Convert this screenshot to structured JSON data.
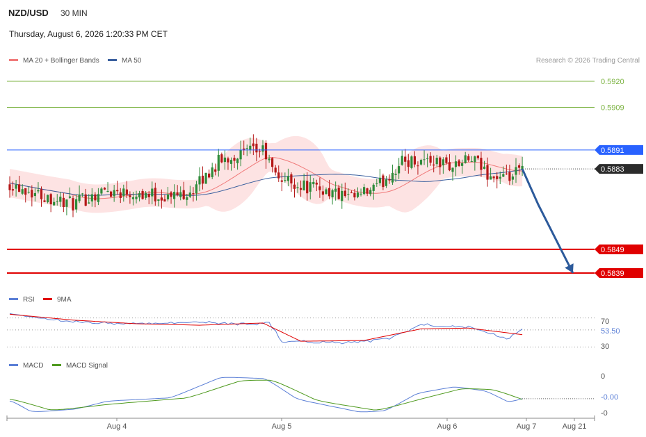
{
  "header": {
    "symbol": "NZD/USD",
    "interval": "30 MIN",
    "datetime": "Thursday, August 6, 2026 1:20:33 PM CET",
    "credit": "Research © 2026 Trading Central"
  },
  "colors": {
    "bollinger_fill": "#fde3e3",
    "ma20": "#f07a7a",
    "ma50": "#3a5f9e",
    "candle_up": "#2e8b3a",
    "candle_down": "#b51818",
    "target_line": "#7cb342",
    "resistance_line": "#2962ff",
    "support_line": "#e00000",
    "arrow": "#2c5a9b",
    "rsi": "#5b7fd6",
    "rsi_ma": "#e00000",
    "macd": "#5b7fd6",
    "macd_signal": "#4f9a1f"
  },
  "chart_data": [
    {
      "type": "candlestick",
      "legend": [
        {
          "name": "MA 20 + Bollinger Bands",
          "color": "#f07a7a"
        },
        {
          "name": "MA 50",
          "color": "#3a5f9e"
        }
      ],
      "y_range": [
        0.5834,
        0.5925
      ],
      "x_labels": [
        "Aug 4",
        "Aug 5",
        "Aug 6",
        "Aug 7",
        "Aug 21"
      ],
      "price_levels": [
        {
          "value": "0.5920",
          "kind": "target"
        },
        {
          "value": "0.5909",
          "kind": "target"
        },
        {
          "value": "0.5891",
          "kind": "resistance"
        },
        {
          "value": "0.5883",
          "kind": "current"
        },
        {
          "value": "0.5849",
          "kind": "support"
        },
        {
          "value": "0.5839",
          "kind": "support"
        }
      ],
      "close_path": [
        {
          "bar": 0,
          "close": 0.5877
        },
        {
          "bar": 10,
          "close": 0.5872
        },
        {
          "bar": 20,
          "close": 0.5868
        },
        {
          "bar": 30,
          "close": 0.5874
        },
        {
          "bar": 40,
          "close": 0.5873
        },
        {
          "bar": 50,
          "close": 0.5871
        },
        {
          "bar": 58,
          "close": 0.5874
        },
        {
          "bar": 66,
          "close": 0.5886
        },
        {
          "bar": 72,
          "close": 0.5889
        },
        {
          "bar": 80,
          "close": 0.5891
        },
        {
          "bar": 84,
          "close": 0.588
        },
        {
          "bar": 92,
          "close": 0.5876
        },
        {
          "bar": 100,
          "close": 0.5874
        },
        {
          "bar": 108,
          "close": 0.587
        },
        {
          "bar": 116,
          "close": 0.5875
        },
        {
          "bar": 124,
          "close": 0.5886
        },
        {
          "bar": 132,
          "close": 0.5887
        },
        {
          "bar": 140,
          "close": 0.5884
        },
        {
          "bar": 146,
          "close": 0.5887
        },
        {
          "bar": 152,
          "close": 0.588
        },
        {
          "bar": 157,
          "close": 0.5878
        },
        {
          "bar": 162,
          "close": 0.5883
        }
      ],
      "forecast": [
        {
          "bar": 162,
          "value": 0.5883
        },
        {
          "bar": 167,
          "value": 0.5868
        },
        {
          "bar": 178,
          "value": 0.5839
        }
      ]
    },
    {
      "type": "line",
      "legend": [
        {
          "name": "RSI",
          "color": "#5b7fd6"
        },
        {
          "name": "9MA",
          "color": "#e00000"
        }
      ],
      "y_range": [
        20,
        82
      ],
      "levels": [
        "70",
        "30"
      ],
      "current_label": "53.50",
      "rsi_path": [
        {
          "bar": 0,
          "value": 75
        },
        {
          "bar": 20,
          "value": 64
        },
        {
          "bar": 40,
          "value": 62
        },
        {
          "bar": 60,
          "value": 64
        },
        {
          "bar": 75,
          "value": 62
        },
        {
          "bar": 82,
          "value": 63
        },
        {
          "bar": 86,
          "value": 38
        },
        {
          "bar": 100,
          "value": 36
        },
        {
          "bar": 110,
          "value": 37
        },
        {
          "bar": 120,
          "value": 42
        },
        {
          "bar": 130,
          "value": 60
        },
        {
          "bar": 145,
          "value": 58
        },
        {
          "bar": 157,
          "value": 40
        },
        {
          "bar": 162,
          "value": 53.5
        }
      ],
      "rsi_ma_path": [
        {
          "bar": 0,
          "value": 75
        },
        {
          "bar": 20,
          "value": 67
        },
        {
          "bar": 40,
          "value": 62
        },
        {
          "bar": 60,
          "value": 60
        },
        {
          "bar": 80,
          "value": 63
        },
        {
          "bar": 92,
          "value": 38
        },
        {
          "bar": 112,
          "value": 39
        },
        {
          "bar": 130,
          "value": 55
        },
        {
          "bar": 145,
          "value": 56
        },
        {
          "bar": 162,
          "value": 47
        }
      ]
    },
    {
      "type": "line",
      "legend": [
        {
          "name": "MACD",
          "color": "#5b7fd6"
        },
        {
          "name": "MACD Signal",
          "color": "#4f9a1f"
        }
      ],
      "y_ticks": [
        "0",
        "-0.00",
        "-0"
      ],
      "macd_path": [
        {
          "bar": 0,
          "value": -0.0003
        },
        {
          "bar": 6,
          "value": -0.001
        },
        {
          "bar": 20,
          "value": -0.0008
        },
        {
          "bar": 30,
          "value": -0.0003
        },
        {
          "bar": 50,
          "value": -0.0001
        },
        {
          "bar": 66,
          "value": 0.0012
        },
        {
          "bar": 80,
          "value": 0.0011
        },
        {
          "bar": 90,
          "value": -0.0002
        },
        {
          "bar": 110,
          "value": -0.001
        },
        {
          "bar": 118,
          "value": -0.0009
        },
        {
          "bar": 128,
          "value": 0.0002
        },
        {
          "bar": 140,
          "value": 0.0006
        },
        {
          "bar": 150,
          "value": 0.0003
        },
        {
          "bar": 157,
          "value": -0.0004
        },
        {
          "bar": 162,
          "value": -0.0001
        }
      ],
      "signal_path": [
        {
          "bar": 0,
          "value": -0.0002
        },
        {
          "bar": 12,
          "value": -0.0009
        },
        {
          "bar": 30,
          "value": -0.0005
        },
        {
          "bar": 55,
          "value": -0.0001
        },
        {
          "bar": 72,
          "value": 0.001
        },
        {
          "bar": 82,
          "value": 0.001
        },
        {
          "bar": 96,
          "value": -0.0003
        },
        {
          "bar": 115,
          "value": -0.0009
        },
        {
          "bar": 128,
          "value": -0.0002
        },
        {
          "bar": 142,
          "value": 0.0005
        },
        {
          "bar": 152,
          "value": 0.0004
        },
        {
          "bar": 162,
          "value": -0.0003
        }
      ]
    }
  ]
}
